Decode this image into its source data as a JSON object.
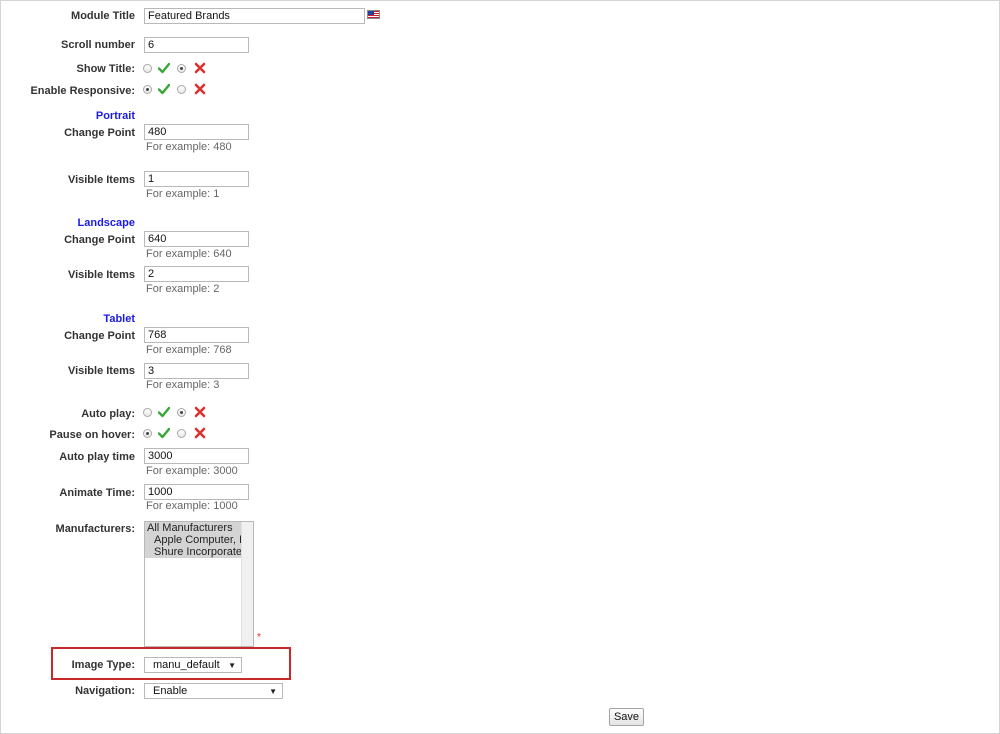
{
  "module_title": {
    "label": "Module Title",
    "value": "Featured Brands"
  },
  "scroll_number": {
    "label": "Scroll number",
    "value": "6"
  },
  "show_title": {
    "label": "Show Title:",
    "selected": "no"
  },
  "enable_responsive": {
    "label": "Enable Responsive:",
    "selected": "yes"
  },
  "portrait": {
    "section": "Portrait",
    "change_point": {
      "label": "Change Point",
      "value": "480",
      "hint": "For example: 480"
    },
    "visible_items": {
      "label": "Visible Items",
      "value": "1",
      "hint": "For example: 1"
    }
  },
  "landscape": {
    "section": "Landscape",
    "change_point": {
      "label": "Change Point",
      "value": "640",
      "hint": "For example: 640"
    },
    "visible_items": {
      "label": "Visible Items",
      "value": "2",
      "hint": "For example: 2"
    }
  },
  "tablet": {
    "section": "Tablet",
    "change_point": {
      "label": "Change Point",
      "value": "768",
      "hint": "For example: 768"
    },
    "visible_items": {
      "label": "Visible Items",
      "value": "3",
      "hint": "For example: 3"
    }
  },
  "auto_play": {
    "label": "Auto play:",
    "selected": "no"
  },
  "pause_on_hover": {
    "label": "Pause on hover:",
    "selected": "yes"
  },
  "auto_play_time": {
    "label": "Auto play time",
    "value": "3000",
    "hint": "For example: 3000"
  },
  "animate_time": {
    "label": "Animate Time:",
    "value": "1000",
    "hint": "For example: 1000"
  },
  "manufacturers": {
    "label": "Manufacturers:",
    "options": [
      "All Manufacturers",
      "Apple Computer, Inc",
      "Shure Incorporated"
    ],
    "required_mark": "*"
  },
  "image_type": {
    "label": "Image Type:",
    "value": "manu_default"
  },
  "navigation": {
    "label": "Navigation:",
    "value": "Enable"
  },
  "save_label": "Save",
  "icons": {
    "yes": "check-icon",
    "no": "cross-icon",
    "flag": "us-flag-icon"
  },
  "colors": {
    "section": "#1a1ae6",
    "highlight": "#c82828",
    "check": "#3aa53a",
    "cross": "#e03030"
  }
}
